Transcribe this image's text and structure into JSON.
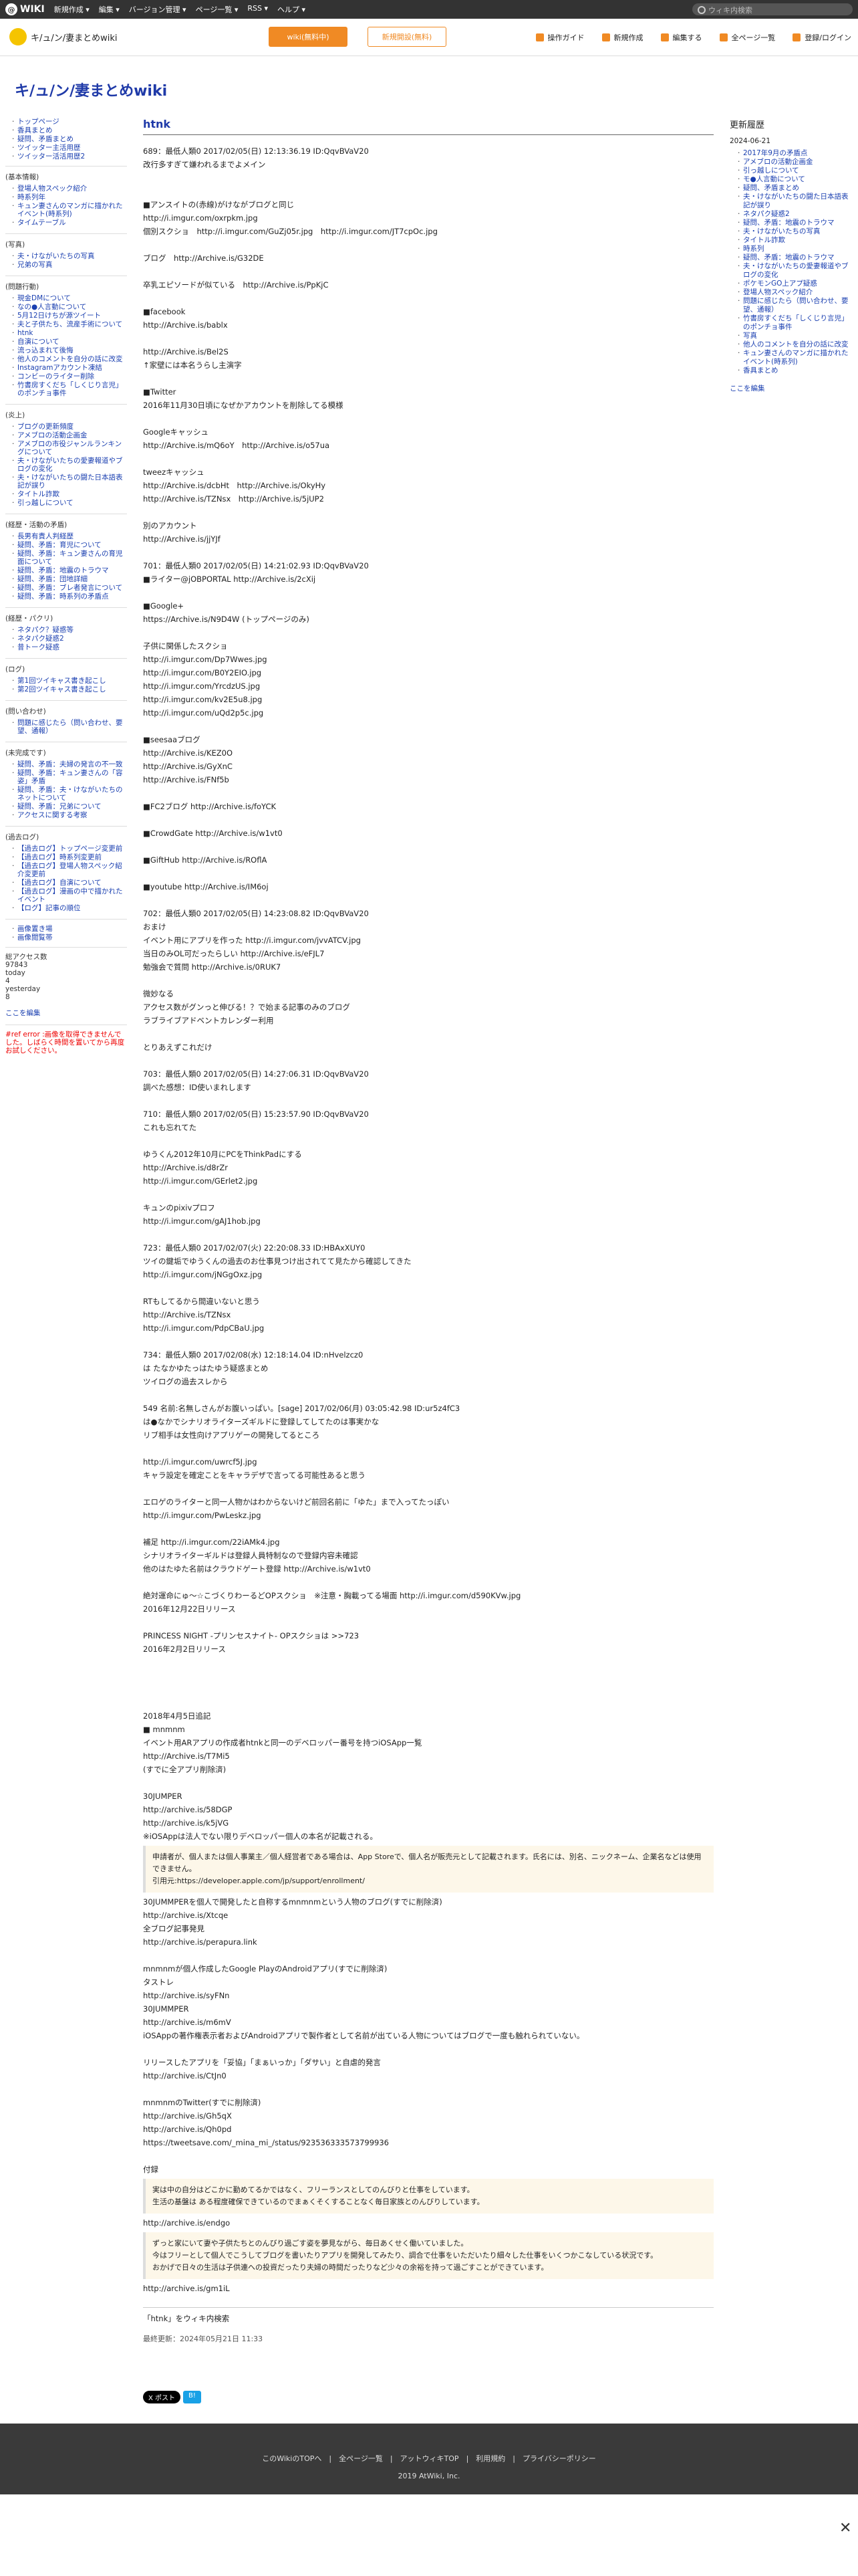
{
  "topbar": {
    "logo": "WIKI",
    "menu": [
      "新規作成",
      "編集",
      "バージョン管理",
      "ページ一覧",
      "RSS",
      "ヘルプ"
    ],
    "search_placeholder": "ウィキ内検索"
  },
  "header": {
    "site": "キ/ュ/ン/妻まとめwiki",
    "btn_orange": "wiki(無料中)",
    "btn_outline": "新規開設(無料)",
    "tools": [
      "操作ガイド",
      "新規作成",
      "編集する",
      "全ページ一覧",
      "登録/ログイン"
    ]
  },
  "page_title": "キ/ュ/ン/妻まとめwiki",
  "leftnav": {
    "top": [
      "トップページ",
      "香具まとめ",
      "疑問、矛盾まとめ",
      "ツイッター主活用歴",
      "ツイッター活活用歴2"
    ],
    "groups": [
      {
        "head": "(基本情報)",
        "items": [
          "登場人物スペック紹介",
          "時系列年",
          "キュン妻さんのマンガに描かれたイベント(時系列)",
          "タイムテーブル"
        ]
      },
      {
        "head": "(写真)",
        "items": [
          "夫・けながいたちの写真",
          "兄弟の写真"
        ]
      },
      {
        "head": "(問題行動)",
        "items": [
          "現金DMについて",
          "なの●人言動について",
          "5月12日けちが源ツイート",
          "夫と子供たち、流産手術について",
          "htnk",
          "自演について",
          "流っ込まれて後悔",
          "他人のコメントを自分の話に改変",
          "Instagramアカウント凍結",
          "コンビーのライター削除",
          "竹書房すくだち「しくじり言児」のポンチョ事件"
        ]
      },
      {
        "head": "(炎上)",
        "items": [
          "ブログの更新頻度",
          "アメブロの活動企画金",
          "アメブロの市役ジャンルランキングについて",
          "夫・けながいたちの愛妻報道やブログの変化",
          "夫・けながいたちの闘た日本語表記が誤り",
          "タイトル詐欺",
          "引っ越しについて"
        ]
      },
      {
        "head": "(経歴・活動の矛盾)",
        "items": [
          "長男有責人判経歴",
          "疑問、矛盾：育児について",
          "疑問、矛盾：キュン妻さんの育児面について",
          "疑問、矛盾：地震のトラウマ",
          "疑問、矛盾：団地詳細",
          "疑問、矛盾：ブレ者発言について",
          "疑問、矛盾：時系列の矛盾点"
        ]
      },
      {
        "head": "(経歴・パクリ)",
        "items": [
          "ネタパク？疑惑等",
          "ネタパク疑惑2",
          "昔トーク疑惑"
        ]
      },
      {
        "head": "(ログ)",
        "items": [
          "第1回ツイキャス書き起こし",
          "第2回ツイキャス書き起こし"
        ]
      },
      {
        "head": "(問い合わせ)",
        "items": [
          "問題に感じたら（問い合わせ、要望、通報）"
        ]
      },
      {
        "head": "(未完成です)",
        "items": [
          "疑問、矛盾：夫婦の発言の不一致",
          "疑問、矛盾：キュン妻さんの「容姿」矛盾",
          "疑問、矛盾：夫・けながいたちのネットについて",
          "疑問、矛盾：兄弟について",
          "アクセスに関する考察"
        ]
      },
      {
        "head": "(過去ログ)",
        "items": [
          "【過去ログ】トップページ変更前",
          "【過去ログ】時系列変更前",
          "【過去ログ】登場人物スペック紹介変更前",
          "【過去ログ】自演について",
          "【過去ログ】漫画の中で描かれたイベント",
          "【ログ】記事の順位"
        ]
      }
    ],
    "extra": [
      "画像置き場",
      "画像閲覧帯"
    ],
    "counter": [
      "総アクセス数",
      "97843",
      "today",
      "4",
      "yesterday",
      "8"
    ],
    "edit": "ここを編集",
    "error": "#ref error :画像を取得できませんでした。しばらく時間を置いてから再度お試しください。"
  },
  "main": {
    "title": "htnk",
    "blocks": [
      {
        "t": "p",
        "text": "689：最低人類0 2017/02/05(日) 12:13:36.19 ID:QqvBVaV20\n改行多すぎて嫌われるまでよメイン\n\n\n■アンスイトの(赤線)がけながブログと同じ\nhttp://i.imgur.com/oxrpkm.jpg\n個別スクショ　http://i.imgur.com/GuZj05r.jpg　http://i.imgur.com/JT7cpOc.jpg\n\nブログ　http://Archive.is/G32DE\n\n卒乳エピソードが似ている　http://Archive.is/PpKjC\n\n■facebook\nhttp://Archive.is/bablx\n\nhttp://Archive.is/Bel2S\n↑家壁には本名うらし主演字\n\n■Twitter\n2016年11月30日頃になぜかアカウントを削除してる模様\n\nGoogleキャッシュ\nhttp://Archive.is/mQ6oY　http://Archive.is/o57ua\n\ntweezキャッシュ\nhttp://Archive.is/dcbHt　http://Archive.is/OkyHy\nhttp://Archive.is/TZNsx　http://Archive.is/5jUP2\n\n別のアカウント\nhttp://Archive.is/jjYJf\n\n701：最低人類0 2017/02/05(日) 14:21:02.93 ID:QqvBVaV20\n■ライター@jOBPORTAL http://Archive.is/2cXij\n\n■Google+\nhttps://Archive.is/N9D4W (トップページのみ)\n\n子供に関係したスクショ\nhttp://i.imgur.com/Dp7Wwes.jpg\nhttp://i.imgur.com/B0Y2EIO.jpg\nhttp://i.imgur.com/YrcdzUS.jpg\nhttp://i.imgur.com/kv2E5u8.jpg\nhttp://i.imgur.com/uQd2p5c.jpg\n\n■seesaaブログ\nhttp://Archive.is/KEZ0O\nhttp://Archive.is/GyXnC\nhttp://Archive.is/FNf5b\n\n■FC2ブログ http://Archive.is/foYCK\n\n■CrowdGate http://Archive.is/w1vt0\n\n■GiftHub http://Archive.is/ROflA\n\n■youtube http://Archive.is/IM6oj\n\n702：最低人類0 2017/02/05(日) 14:23:08.82 ID:QqvBVaV20\nおまけ\nイベント用にアプリを作った http://i.imgur.com/jvvATCV.jpg\n当日のみOL可だったらしい http://Archive.is/eFJL7\n勉強会で質問 http://Archive.is/0RUK7\n\n微妙なる\nアクセス数がグンっと伸びる！？で始まる記事のみのブログ\nラブライブアドベントカレンダー利用\n\nとりあえずこれだけ\n\n703：最低人類0 2017/02/05(日) 14:27:06.31 ID:QqvBVaV20\n調べた感想：ID使いまれします\n\n710：最低人類0 2017/02/05(日) 15:23:57.90 ID:QqvBVaV20\nこれも忘れてた\n\nゆうくん2012年10月にPCをThinkPadにする\nhttp://Archive.is/d8rZr\nhttp://i.imgur.com/GErlet2.jpg\n\nキュンのpixivプロフ\nhttp://i.imgur.com/gAJ1hob.jpg\n\n723：最低人類0 2017/02/07(火) 22:20:08.33 ID:HBAxXUY0\nツイの鍵垢でゆうくんの過去のお仕事見つけ出されてて見たから確認してきた\nhttp://i.imgur.com/jNGgOxz.jpg\n\nRTもしてるから間違いないと思う\nhttp://Archive.is/TZNsx\nhttp://i.imgur.com/PdpCBaU.jpg\n\n734：最低人類0 2017/02/08(水) 12:18:14.04 ID:nHvelzcz0\nは たなかゆたっはたゆう疑惑まとめ\nツイログの過去スレから\n\n549 名前:名無しさんがお腹いっぱい。[sage] 2017/02/06(月) 03:05:42.98 ID:ur5z4fC3\nは●なかでシナリオライターズギルドに登録してしてたのは事実かな\nリブ相手は女性向けアプリゲーの開発してるところ\n\nhttp://i.imgur.com/uwrcf5J.jpg\nキャラ設定を確定ことをキャラデザで言ってる可能性あると思う\n\nエロゲのライターと同一人物かはわからないけど前回名前に「ゆた」まで入ってたっぽい\nhttp://i.imgur.com/PwLeskz.jpg\n\n補足 http://i.imgur.com/22iAMk4.jpg\nシナリオライターギルドは登録人員特制なので登録内容未確認\n他のはたゆた名前はクラウドゲート登録 http://Archive.is/w1vt0\n\n絶対運命にゅ〜☆こづくりわーるどOPスクショ　※注意・胸載ってる場面 http://i.imgur.com/d590KVw.jpg\n2016年12月22日リリース\n\nPRINCESS NIGHT -プリンセスナイト- OPスクショは >>723\n2016年2月2日リリース\n\n\n\n\n2018年4月5日追記\n■ mnmnm\nイベント用ARアプリの作成者htnkと同一のデベロッパー番号を持つiOSApp一覧\nhttp://Archive.is/T7Mi5\n(すでに全アプリ削除済)\n\n30JUMPER\nhttp://archive.is/58DGP\nhttp://archive.is/k5jVG\n※iOSAppは法人でない限りデベロッパー個人の本名が記載される。"
      },
      {
        "t": "q",
        "text": "申請者が、個人または個人事業主／個人経営者である場合は、App Storeで、個人名が販売元として記載されます。氏名には、別名、ニックネーム、企業名などは使用できません。\n引用元:https://developer.apple.com/jp/support/enrollment/"
      },
      {
        "t": "p",
        "text": "30JUMMPERを個人で開発したと自称するmnmnmという人物のブログ(すでに削除済)\nhttp://archive.is/Xtcqe\n全ブログ記事発見\nhttp://archive.is/perapura.link\n\nmnmnmが個人作成したGoogle PlayのAndroidアプリ(すでに削除済)\nタストレ\nhttp://archive.is/syFNn\n30JUMMPER\nhttp://archive.is/m6mV\niOSAppの著作権表示者およびAndroidアプリで製作者として名前が出ている人物についてはブログで一度も触れられていない。\n\nリリースしたアプリを「妥協」「まぁいっか」「ダサい」と自虐的発言\nhttp://archive.is/CtJn0\n\nmnmnmのTwitter(すでに削除済)\nhttp://archive.is/Gh5qX\nhttp://archive.is/Qh0pd\nhttps://tweetsave.com/_mina_mi_/status/923536333573799936\n\n付録"
      },
      {
        "t": "q",
        "text": "実は中の自分はどこかに勤めてるかではなく、フリーランスとしてのんびりと仕事をしています。\n生活の基盤は ある程度確保できているのでまぁくそくすることなく毎日家族とのんびりしています。"
      },
      {
        "t": "p",
        "text": "http://archive.is/endgo\n"
      },
      {
        "t": "q",
        "text": "ずっと家にいて妻や子供たちとのんびり過ごす姿を夢見ながら、毎日あくせく働いていました。\n今はフリーとして個人でこうしてブログを書いたりアプリを開発してみたり、調合で仕事をいただいたり細々した仕事をいくつかこなしている状況です。\nおかげで日々の生活は子供連への投資だったり夫婦の時間だったりなど少々の余裕を持って過ごすことができています。"
      },
      {
        "t": "p",
        "text": "http://archive.is/gm1iL"
      }
    ],
    "search": "「htnk」をウィキ内検索",
    "updated": "最終更新：2024年05月21日 11:33",
    "social": [
      "X ポスト",
      "B!"
    ]
  },
  "rightnav": {
    "head": "更新履歴",
    "date": "2024-06-21",
    "items": [
      "2017年9月の矛盾点",
      "アメブロの活動企画金",
      "引っ越しについて",
      "モ●人言動について",
      "疑問、矛盾まとめ",
      "夫・けながいたちの闘た日本語表記が誤り",
      "ネタパク疑惑2",
      "疑問、矛盾：地震のトラウマ",
      "夫・けながいたちの写真",
      "タイトル詐欺",
      "時系列",
      "疑問、矛盾：地震のトラウマ",
      "夫・けながいたちの愛妻報道やブログの変化",
      "ポケモンGO上アプ疑惑",
      "登場人物スペック紹介",
      "問題に感じたら（問い合わせ、要望、通報）",
      "竹書房すくだち「しくじり言児」のポンチョ事件",
      "写真",
      "他人のコメントを自分の話に改変",
      "キュン妻さんのマンガに描かれたイベント(時系列)",
      "香具まとめ"
    ],
    "edit": "ここを編集"
  },
  "footer": {
    "links": "このWikiのTOPへ　|　全ページ一覧　|　アットウィキTOP　|　利用規約　|　プライバシーポリシー",
    "copy": "2019 AtWiki, Inc."
  }
}
